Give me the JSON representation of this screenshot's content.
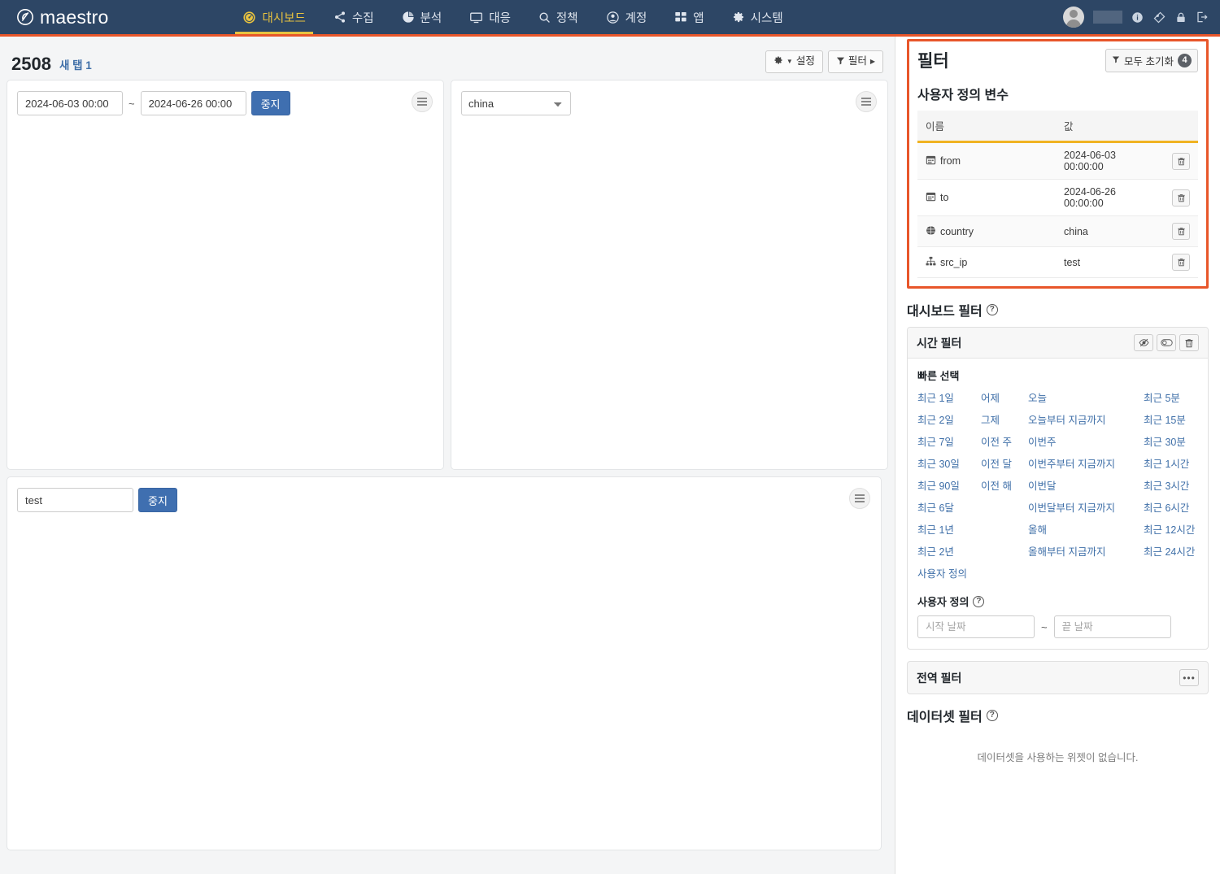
{
  "brand": {
    "name": "maestro",
    "logo_icon": "maestro-logo-icon"
  },
  "nav": {
    "items": [
      {
        "label": "대시보드",
        "icon": "dashboard-gauge-icon",
        "active": true
      },
      {
        "label": "수집",
        "icon": "share-nodes-icon",
        "active": false
      },
      {
        "label": "분석",
        "icon": "pie-chart-icon",
        "active": false
      },
      {
        "label": "대응",
        "icon": "monitor-icon",
        "active": false
      },
      {
        "label": "정책",
        "icon": "search-icon",
        "active": false
      },
      {
        "label": "계정",
        "icon": "user-circle-icon",
        "active": false
      },
      {
        "label": "앱",
        "icon": "grid-apps-icon",
        "active": false
      },
      {
        "label": "시스템",
        "icon": "gear-icon",
        "active": false
      }
    ],
    "right_icons": [
      "avatar",
      "username-mask",
      "info-icon",
      "tag-icon",
      "lock-icon",
      "logout-icon"
    ]
  },
  "title": {
    "dashboard_id": "2508",
    "tab_name": "새 탭 1",
    "settings_label": "설정",
    "filter_label": "필터"
  },
  "widgets": {
    "date_widget": {
      "from_value": "2024-06-03 00:00",
      "to_value": "2024-06-26 00:00",
      "separator": "~",
      "stop_label": "중지"
    },
    "country_widget": {
      "selected": "china",
      "options": [
        "china"
      ]
    },
    "text_widget": {
      "value": "test",
      "stop_label": "중지"
    }
  },
  "filter_panel": {
    "title": "필터",
    "reset_all_label": "모두 초기화",
    "reset_all_count": "4",
    "user_vars": {
      "heading": "사용자 정의 변수",
      "columns": [
        "이름",
        "값"
      ],
      "rows": [
        {
          "icon": "calendar-icon",
          "name": "from",
          "value": "2024-06-03 00:00:00",
          "delete_icon": "trash-icon"
        },
        {
          "icon": "calendar-icon",
          "name": "to",
          "value": "2024-06-26 00:00:00",
          "delete_icon": "trash-icon"
        },
        {
          "icon": "globe-icon",
          "name": "country",
          "value": "china",
          "delete_icon": "trash-icon"
        },
        {
          "icon": "sitemap-icon",
          "name": "src_ip",
          "value": "test",
          "delete_icon": "trash-icon"
        }
      ]
    },
    "dashboard_filter": {
      "heading": "대시보드 필터",
      "help_icon": "question-circle-icon",
      "time_filter": {
        "title": "시간 필터",
        "actions": [
          "eye-slash-icon",
          "toggle-icon",
          "trash-icon"
        ],
        "quick_select_heading": "빠른 선택",
        "quick_select": [
          [
            "최근 1일",
            "어제",
            "오늘",
            "최근 5분"
          ],
          [
            "최근 2일",
            "그제",
            "오늘부터 지금까지",
            "최근 15분"
          ],
          [
            "최근 7일",
            "이전 주",
            "이번주",
            "최근 30분"
          ],
          [
            "최근 30일",
            "이전 달",
            "이번주부터 지금까지",
            "최근 1시간"
          ],
          [
            "최근 90일",
            "이전 해",
            "이번달",
            "최근 3시간"
          ],
          [
            "최근 6달",
            "",
            "이번달부터 지금까지",
            "최근 6시간"
          ],
          [
            "최근 1년",
            "",
            "올해",
            "최근 12시간"
          ],
          [
            "최근 2년",
            "",
            "올해부터 지금까지",
            "최근 24시간"
          ],
          [
            "사용자 정의",
            "",
            "",
            ""
          ]
        ],
        "custom_heading": "사용자 정의",
        "start_placeholder": "시작 날짜",
        "end_placeholder": "끝 날짜",
        "date_separator": "~"
      }
    },
    "global_filter": {
      "title": "전역 필터",
      "menu_icon": "ellipsis-icon"
    },
    "dataset_filter": {
      "heading": "데이터셋 필터",
      "help_icon": "question-circle-icon",
      "empty_message": "데이터셋을 사용하는 위젯이 없습니다."
    }
  },
  "colors": {
    "nav_bg": "#2d4665",
    "nav_active": "#e9c33f",
    "accent_orange": "#e8562a",
    "table_underline": "#f0b323",
    "link_blue": "#3f6fa8",
    "button_blue": "#3f6fb0"
  }
}
